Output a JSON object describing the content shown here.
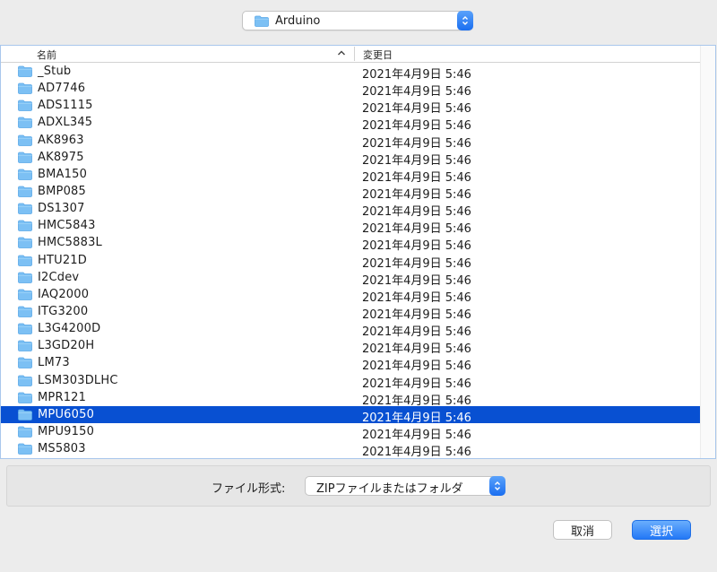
{
  "location": {
    "folder": "Arduino"
  },
  "columns": {
    "name": "名前",
    "date": "変更日"
  },
  "rows": [
    {
      "name": "_Stub",
      "date": "2021年4月9日 5:46",
      "selected": false
    },
    {
      "name": "AD7746",
      "date": "2021年4月9日 5:46",
      "selected": false
    },
    {
      "name": "ADS1115",
      "date": "2021年4月9日 5:46",
      "selected": false
    },
    {
      "name": "ADXL345",
      "date": "2021年4月9日 5:46",
      "selected": false
    },
    {
      "name": "AK8963",
      "date": "2021年4月9日 5:46",
      "selected": false
    },
    {
      "name": "AK8975",
      "date": "2021年4月9日 5:46",
      "selected": false
    },
    {
      "name": "BMA150",
      "date": "2021年4月9日 5:46",
      "selected": false
    },
    {
      "name": "BMP085",
      "date": "2021年4月9日 5:46",
      "selected": false
    },
    {
      "name": "DS1307",
      "date": "2021年4月9日 5:46",
      "selected": false
    },
    {
      "name": "HMC5843",
      "date": "2021年4月9日 5:46",
      "selected": false
    },
    {
      "name": "HMC5883L",
      "date": "2021年4月9日 5:46",
      "selected": false
    },
    {
      "name": "HTU21D",
      "date": "2021年4月9日 5:46",
      "selected": false
    },
    {
      "name": "I2Cdev",
      "date": "2021年4月9日 5:46",
      "selected": false
    },
    {
      "name": "IAQ2000",
      "date": "2021年4月9日 5:46",
      "selected": false
    },
    {
      "name": "ITG3200",
      "date": "2021年4月9日 5:46",
      "selected": false
    },
    {
      "name": "L3G4200D",
      "date": "2021年4月9日 5:46",
      "selected": false
    },
    {
      "name": "L3GD20H",
      "date": "2021年4月9日 5:46",
      "selected": false
    },
    {
      "name": "LM73",
      "date": "2021年4月9日 5:46",
      "selected": false
    },
    {
      "name": "LSM303DLHC",
      "date": "2021年4月9日 5:46",
      "selected": false
    },
    {
      "name": "MPR121",
      "date": "2021年4月9日 5:46",
      "selected": false
    },
    {
      "name": "MPU6050",
      "date": "2021年4月9日 5:46",
      "selected": true
    },
    {
      "name": "MPU9150",
      "date": "2021年4月9日 5:46",
      "selected": false
    },
    {
      "name": "MS5803",
      "date": "2021年4月9日 5:46",
      "selected": false
    }
  ],
  "file_format": {
    "label": "ファイル形式:",
    "value": "ZIPファイルまたはフォルダ"
  },
  "buttons": {
    "cancel": "取消",
    "ok": "選択"
  },
  "icons": {
    "folder": "folder-icon",
    "sort": "chevron-up-icon",
    "popup": "up-down-chevron-icon"
  },
  "colors": {
    "selection": "#0850d2",
    "accent": "#2378f6",
    "folder": "#7cc0f4"
  }
}
